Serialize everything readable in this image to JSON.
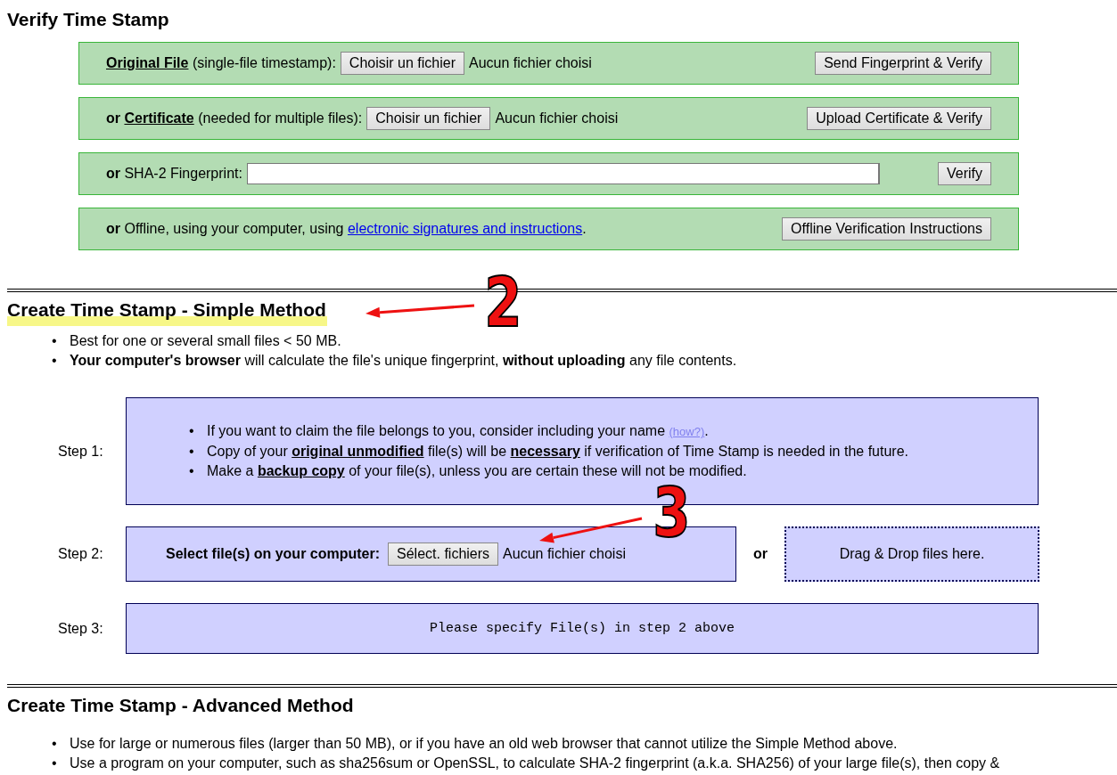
{
  "verify": {
    "title": "Verify Time Stamp",
    "rows": [
      {
        "kind": "file",
        "parts": [
          {
            "kind": "term",
            "text": "Original File"
          },
          {
            "kind": "text",
            "text": " (single-file timestamp):"
          }
        ],
        "choose_button": "Choisir un fichier",
        "file_status": "Aucun fichier choisi",
        "action": "Send Fingerprint & Verify"
      },
      {
        "kind": "file",
        "parts": [
          {
            "kind": "bold",
            "text": "or "
          },
          {
            "kind": "term",
            "text": "Certificate"
          },
          {
            "kind": "text",
            "text": " (needed for multiple files):"
          }
        ],
        "choose_button": "Choisir un fichier",
        "file_status": "Aucun fichier choisi",
        "action": "Upload Certificate & Verify"
      },
      {
        "kind": "text",
        "parts": [
          {
            "kind": "bold",
            "text": "or"
          },
          {
            "kind": "text",
            "text": " SHA-2 Fingerprint:"
          }
        ],
        "action": "Verify"
      },
      {
        "kind": "link",
        "parts": [
          {
            "kind": "bold",
            "text": "or"
          },
          {
            "kind": "text",
            "text": " Offline, using your computer, using "
          },
          {
            "kind": "link",
            "text": "electronic signatures and instructions"
          },
          {
            "kind": "text",
            "text": "."
          }
        ],
        "action": "Offline Verification Instructions"
      }
    ]
  },
  "simple": {
    "title": "Create Time Stamp - Simple Method",
    "highlighted": true,
    "bullets": [
      {
        "marker": "•",
        "parts": [
          {
            "kind": "text",
            "text": "Best for one or several small files < 50 MB."
          }
        ]
      },
      {
        "marker": "•",
        "parts": [
          {
            "kind": "bold",
            "text": "Your computer's browser"
          },
          {
            "kind": "text",
            "text": " will calculate the file's unique fingerprint, "
          },
          {
            "kind": "bold",
            "text": "without uploading"
          },
          {
            "kind": "text",
            "text": " any file contents."
          }
        ]
      }
    ],
    "steps": [
      {
        "kind": "notes",
        "label": "Step 1:",
        "bullets": [
          {
            "marker": "•",
            "parts": [
              {
                "kind": "text",
                "text": "If you want to claim the file belongs to you, consider including your name "
              },
              {
                "kind": "small-link",
                "text": "(how?)"
              },
              {
                "kind": "text",
                "text": "."
              }
            ]
          },
          {
            "marker": "•",
            "parts": [
              {
                "kind": "text",
                "text": "Copy of your "
              },
              {
                "kind": "term",
                "text": "original unmodified"
              },
              {
                "kind": "text",
                "text": " file(s) will be "
              },
              {
                "kind": "term",
                "text": "necessary"
              },
              {
                "kind": "text",
                "text": " if verification of Time Stamp is needed in the future."
              }
            ]
          },
          {
            "marker": "•",
            "parts": [
              {
                "kind": "text",
                "text": "Make a "
              },
              {
                "kind": "term",
                "text": "backup copy"
              },
              {
                "kind": "text",
                "text": " of your file(s), unless you are certain these will not be modified."
              }
            ]
          }
        ]
      },
      {
        "kind": "select",
        "label": "Step 2:",
        "prompt": "Select file(s) on your computer:",
        "choose_button": "Sélect. fichiers",
        "file_status": "Aucun fichier choisi",
        "or": "or",
        "drop_zone": "Drag & Drop files here."
      },
      {
        "kind": "status",
        "label": "Step 3:",
        "message": "Please specify File(s) in step 2 above"
      }
    ]
  },
  "advanced": {
    "title": "Create Time Stamp - Advanced Method",
    "bullets": [
      {
        "marker": "•",
        "parts": [
          {
            "kind": "text",
            "text": "Use for large or numerous files (larger than 50 MB), or if you have an old web browser that cannot utilize the Simple Method above."
          }
        ]
      },
      {
        "marker": "•",
        "parts": [
          {
            "kind": "text",
            "text": "Use a program on your computer, such as sha256sum or OpenSSL, to calculate SHA-2 fingerprint (a.k.a. SHA256) of your large file(s), then copy &"
          }
        ]
      }
    ]
  },
  "annotations": [
    {
      "number": "2"
    },
    {
      "number": "3"
    }
  ]
}
